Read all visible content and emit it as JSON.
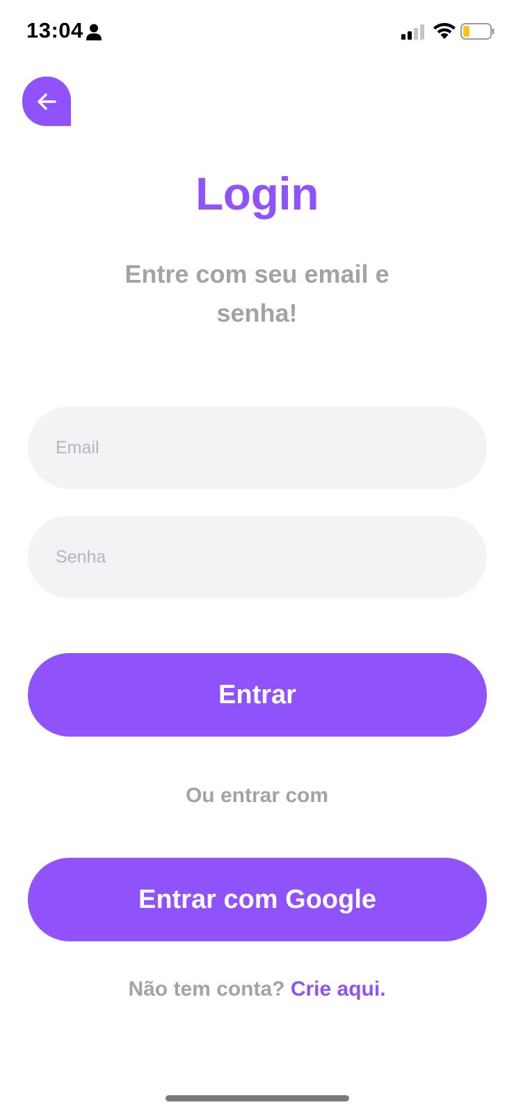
{
  "status_bar": {
    "time": "13:04",
    "icons": [
      "person-icon",
      "cellular-signal-icon",
      "wifi-icon",
      "battery-low-icon"
    ]
  },
  "header": {
    "back_icon": "arrow-left-icon"
  },
  "title": "Login",
  "subtitle": "Entre com seu email e senha!",
  "form": {
    "email_placeholder": "Email",
    "email_value": "",
    "password_placeholder": "Senha",
    "password_value": "",
    "submit_label": "Entrar"
  },
  "divider_text": "Ou entrar com",
  "google_button_label": "Entrar com Google",
  "signup": {
    "prompt": "Não tem conta?",
    "link": "Crie aqui."
  },
  "colors": {
    "accent": "#8f52fb",
    "muted_text": "#a3a3a3",
    "input_bg": "#f2f3f5",
    "battery_level": "#f5c518"
  }
}
